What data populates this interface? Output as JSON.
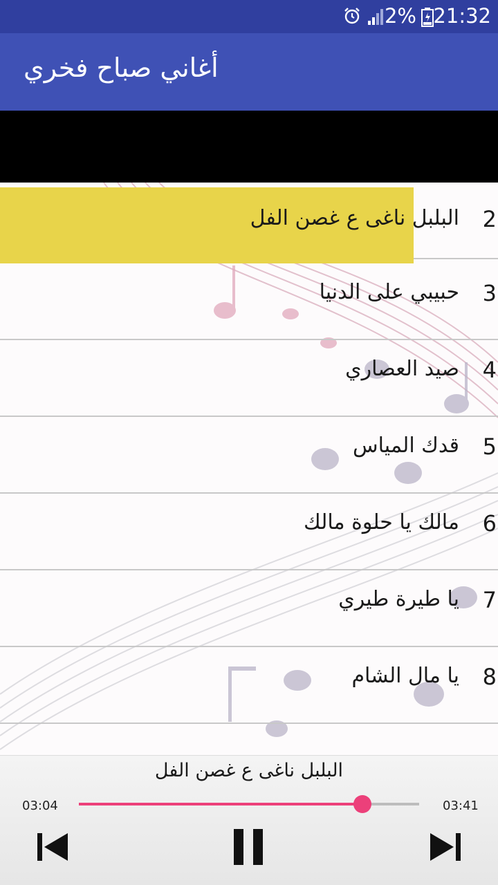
{
  "status_bar": {
    "time": "21:32",
    "battery": "2%",
    "icons": [
      "alarm-icon",
      "signal-icon",
      "battery-icon"
    ]
  },
  "app_bar": {
    "title": "أغاني صباح فخري"
  },
  "playlist": {
    "items": [
      {
        "num": "2",
        "title": "البلبل ناغى ع غصن الفل",
        "active": true
      },
      {
        "num": "3",
        "title": "حبيبي على الدنيا",
        "active": false
      },
      {
        "num": "4",
        "title": "صيد العصاري",
        "active": false
      },
      {
        "num": "5",
        "title": "قدك المياس",
        "active": false
      },
      {
        "num": "6",
        "title": "مالك يا حلوة مالك",
        "active": false
      },
      {
        "num": "7",
        "title": "يا طيرة طيري",
        "active": false
      },
      {
        "num": "8",
        "title": "يا مال الشام",
        "active": false
      }
    ]
  },
  "player": {
    "now_playing": "البلبل ناغى ع غصن الفل",
    "elapsed": "03:04",
    "total": "03:41",
    "progress": 0.833,
    "icons": [
      "skip-previous-icon",
      "pause-icon",
      "skip-next-icon"
    ]
  },
  "colors": {
    "status_bar": "#303f9f",
    "app_bar": "#3f51b5",
    "highlight": "#e8d44a",
    "accent": "#ec407a"
  }
}
